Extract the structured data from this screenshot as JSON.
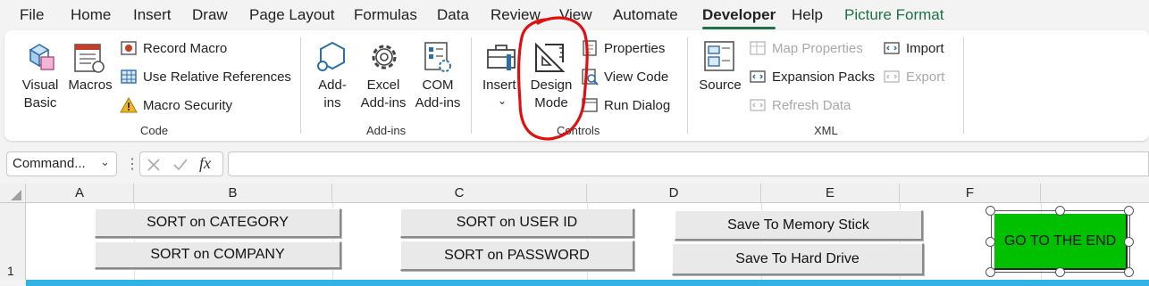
{
  "menu": {
    "tabs": [
      "File",
      "Home",
      "Insert",
      "Draw",
      "Page Layout",
      "Formulas",
      "Data",
      "Review",
      "View",
      "Automate",
      "Developer",
      "Help",
      "Picture Format"
    ],
    "active": "Developer"
  },
  "ribbon": {
    "code": {
      "group_label": "Code",
      "visual_basic": "Visual Basic",
      "visual_basic_l1": "Visual",
      "visual_basic_l2": "Basic",
      "macros": "Macros",
      "record_macro": "Record Macro",
      "use_relative_references": "Use Relative References",
      "macro_security": "Macro Security"
    },
    "addins": {
      "group_label": "Add-ins",
      "addins_l1": "Add-",
      "addins_l2": "ins",
      "excel_addins_l1": "Excel",
      "excel_addins_l2": "Add-ins",
      "com_addins_l1": "COM",
      "com_addins_l2": "Add-ins"
    },
    "controls": {
      "group_label": "Controls",
      "insert": "Insert",
      "design_mode_l1": "Design",
      "design_mode_l2": "Mode",
      "properties": "Properties",
      "view_code": "View Code",
      "run_dialog": "Run Dialog"
    },
    "xml": {
      "group_label": "XML",
      "source": "Source",
      "map_properties": "Map Properties",
      "expansion_packs": "Expansion Packs",
      "refresh_data": "Refresh Data",
      "import": "Import",
      "export": "Export"
    }
  },
  "formula_bar": {
    "name_box": "Command...",
    "fx": "fx",
    "value": ""
  },
  "grid": {
    "columns": [
      "A",
      "B",
      "C",
      "D",
      "E",
      "F"
    ],
    "rows": [
      "1"
    ]
  },
  "sheet_buttons": {
    "sort_category": "SORT on CATEGORY",
    "sort_company": "SORT on COMPANY",
    "sort_user_id": "SORT on USER ID",
    "sort_password": "SORT on PASSWORD",
    "save_memory_stick": "Save To Memory Stick",
    "save_hard_drive": "Save To Hard Drive",
    "go_to_end": "GO TO THE END"
  },
  "colors": {
    "accent_green": "#1e7145",
    "go_button_green": "#00c000",
    "annotation_red": "#e01010"
  }
}
